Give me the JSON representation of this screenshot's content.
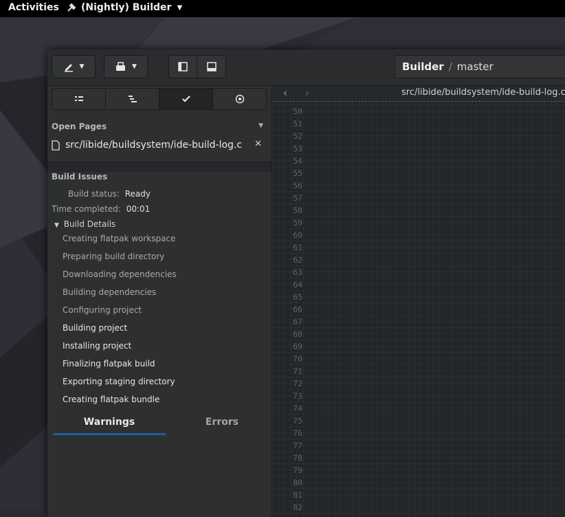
{
  "topbar": {
    "activities": "Activities",
    "app_name": "(Nightly) Builder"
  },
  "header": {
    "project": "Builder",
    "separator": "/",
    "branch": "master"
  },
  "sidebar": {
    "open_pages_title": "Open Pages",
    "open_file": "src/libide/buildsystem/ide-build-log.c",
    "build_issues_title": "Build Issues",
    "build_status_label": "Build status:",
    "build_status_value": "Ready",
    "time_completed_label": "Time completed:",
    "time_completed_value": "00:01",
    "build_details_label": "Build Details",
    "steps": [
      {
        "label": "Creating flatpak workspace",
        "done": true
      },
      {
        "label": "Preparing build directory",
        "done": true
      },
      {
        "label": "Downloading dependencies",
        "done": true
      },
      {
        "label": "Building dependencies",
        "done": true
      },
      {
        "label": "Configuring project",
        "done": true
      },
      {
        "label": "Building project",
        "done": false
      },
      {
        "label": "Installing project",
        "done": false
      },
      {
        "label": "Finalizing flatpak build",
        "done": false
      },
      {
        "label": "Exporting staging directory",
        "done": false
      },
      {
        "label": "Creating flatpak bundle",
        "done": false
      }
    ],
    "tabs": [
      "Warnings",
      "Errors"
    ],
    "active_tab": "Warnings"
  },
  "editor": {
    "path": "src/libide/buildsystem/ide-build-log.c",
    "first_line": 50,
    "lines": [
      "50",
      "51",
      "52",
      "53",
      "54",
      "55",
      "56",
      "57",
      "58",
      "59",
      "60",
      "61",
      "62",
      "63",
      "64",
      "65",
      "66",
      "67",
      "68",
      "69",
      "70",
      "71",
      "72",
      "73",
      "74",
      "75",
      "76",
      "77",
      "78",
      "79",
      "80",
      "81",
      "82"
    ]
  },
  "colors": {
    "accent": "#215d9c",
    "keyword": "#ddb018",
    "type": "#8ac83c",
    "function": "#4fa8d7"
  }
}
